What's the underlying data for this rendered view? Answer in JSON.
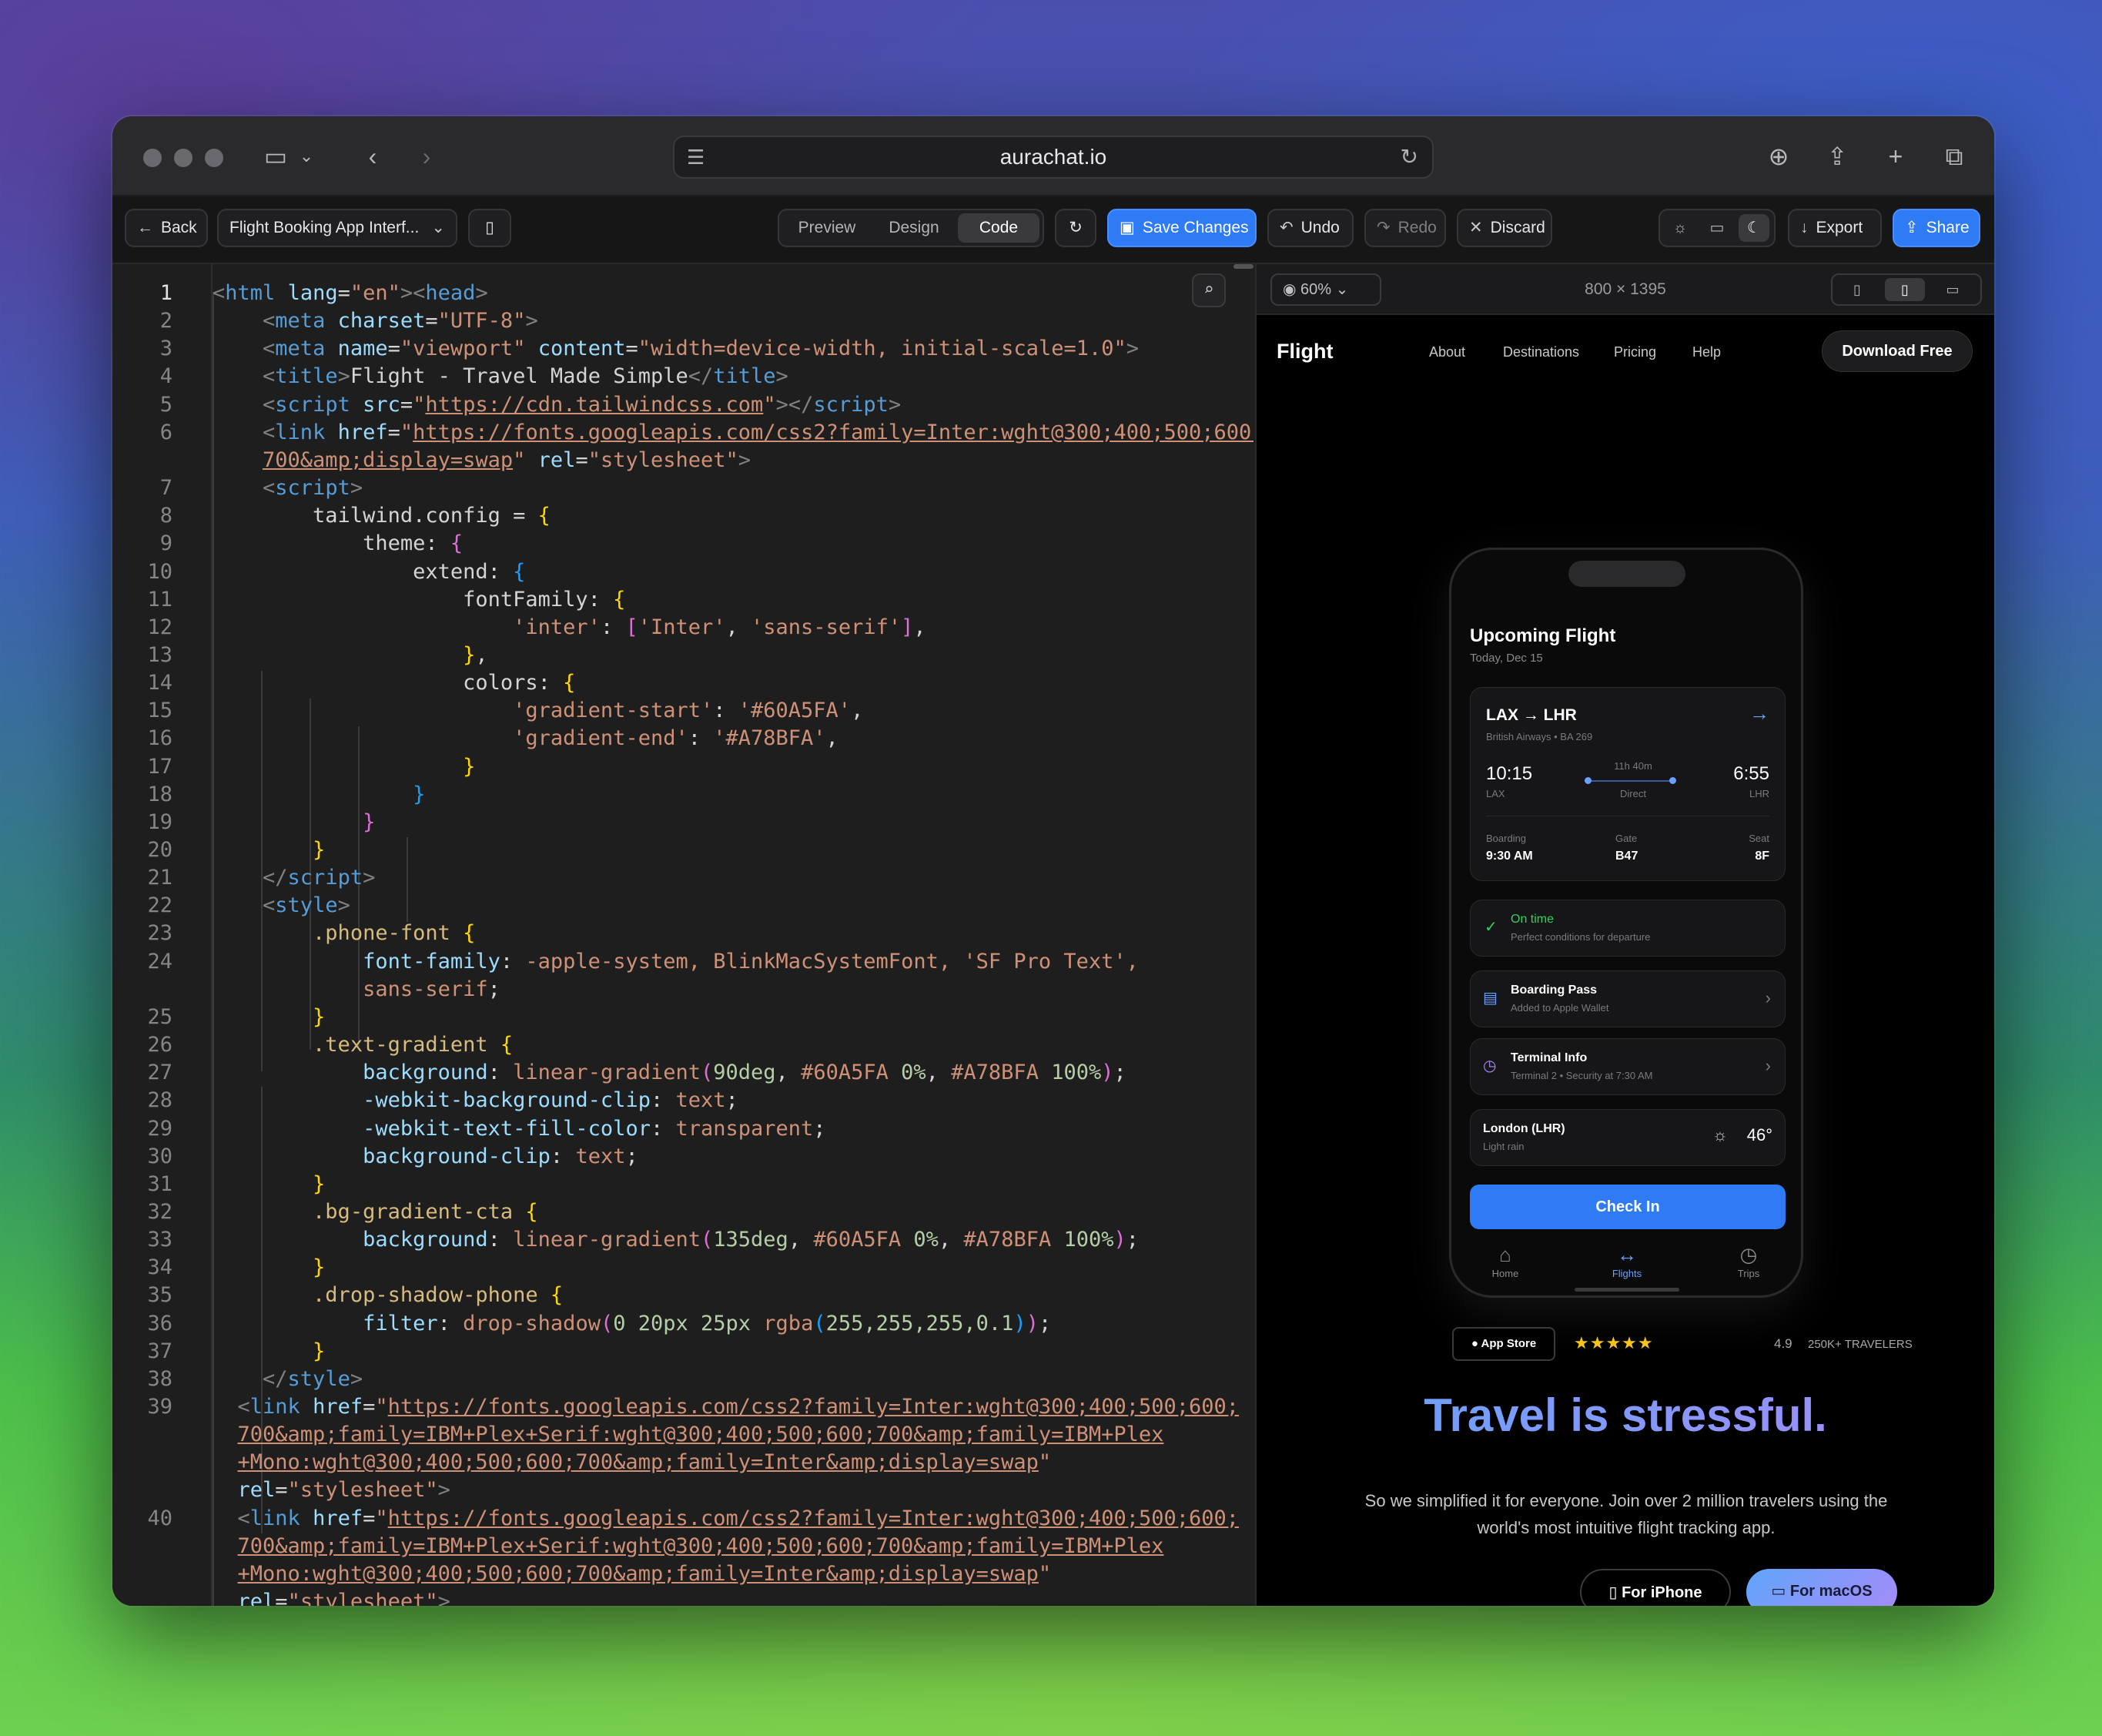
{
  "browser": {
    "url": "aurachat.io"
  },
  "toolbar": {
    "back_label": "Back",
    "project_name": "Flight Booking App Interf...",
    "tabs": [
      {
        "label": "Preview"
      },
      {
        "label": "Design"
      },
      {
        "label": "Code"
      }
    ],
    "save_label": "Save Changes",
    "undo_label": "Undo",
    "redo_label": "Redo",
    "discard_label": "Discard",
    "export_label": "Export",
    "share_label": "Share",
    "accent_color": "#2f7bf6"
  },
  "preview_bar": {
    "zoom": "60%",
    "dimensions": "800 × 1395"
  },
  "code": {
    "active_line": 1,
    "line_numbers": [
      "1",
      "2",
      "3",
      "4",
      "5",
      "6",
      "",
      "7",
      "8",
      "9",
      "10",
      "11",
      "12",
      "13",
      "14",
      "15",
      "16",
      "17",
      "18",
      "19",
      "20",
      "21",
      "22",
      "23",
      "24",
      "",
      "25",
      "26",
      "27",
      "28",
      "29",
      "30",
      "31",
      "32",
      "33",
      "34",
      "35",
      "36",
      "37",
      "38",
      "39",
      "",
      "",
      "",
      "40",
      "",
      "",
      ""
    ]
  },
  "app_preview": {
    "nav": {
      "brand": "Flight",
      "links": [
        "About",
        "Destinations",
        "Pricing",
        "Help"
      ],
      "download": "Download Free"
    },
    "phone": {
      "title": "Upcoming Flight",
      "subtitle": "Today, Dec 15",
      "route": "LAX → LHR",
      "airline": "British Airways • BA 269",
      "depart_time": "10:15",
      "depart_code": "LAX",
      "duration": "11h 40m",
      "stops": "Direct",
      "arrive_time": "6:55",
      "arrive_code": "LHR",
      "boarding_label": "Boarding",
      "boarding_value": "9:30 AM",
      "gate_label": "Gate",
      "gate_value": "B47",
      "seat_label": "Seat",
      "seat_value": "8F",
      "status_title": "On time",
      "status_sub": "Perfect conditions for departure",
      "pass_title": "Boarding Pass",
      "pass_sub": "Added to Apple Wallet",
      "terminal_title": "Terminal Info",
      "terminal_sub": "Terminal 2 • Security at 7:30 AM",
      "weather_city": "London (LHR)",
      "weather_cond": "Light rain",
      "weather_temp": "46°",
      "checkin": "Check In",
      "tabs": [
        {
          "label": "Home"
        },
        {
          "label": "Flights"
        },
        {
          "label": "Trips"
        }
      ],
      "status_color": "#34d058"
    },
    "store_badge": "App Store",
    "stars": "★★★★★",
    "rating": "4.9",
    "travelers": "250K+ TRAVELERS",
    "hero_title": "Travel is stressful.",
    "hero_sub": "So we simplified it for everyone. Join over 2 million travelers using the world's most intuitive flight tracking app.",
    "cta_iphone": "For iPhone",
    "cta_mac": "For macOS"
  }
}
